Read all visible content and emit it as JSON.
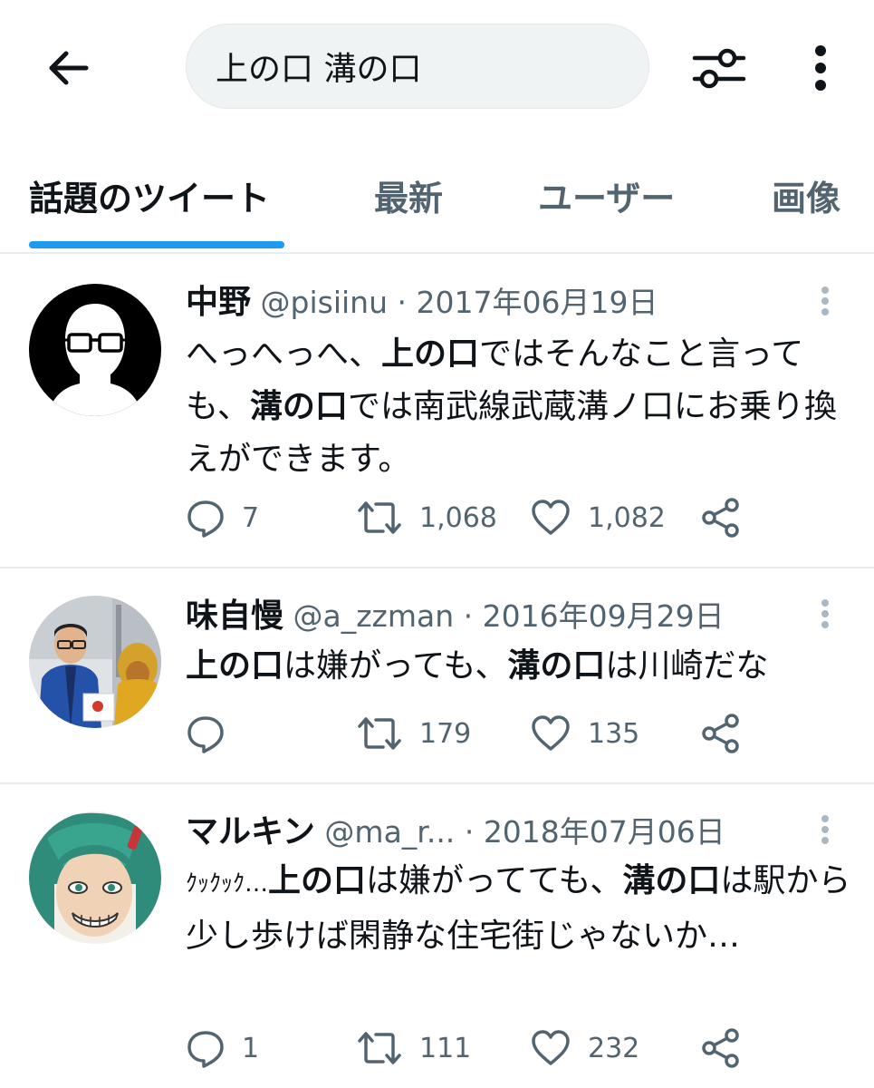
{
  "search": {
    "query": "上の口 溝の口"
  },
  "tabs": [
    {
      "label": "話題のツイート",
      "active": true
    },
    {
      "label": "最新",
      "active": false
    },
    {
      "label": "ユーザー",
      "active": false
    },
    {
      "label": "画像",
      "active": false
    }
  ],
  "tweets": [
    {
      "name": "中野",
      "handle": "@pisiinu",
      "separator": "·",
      "date": "2017年06月19日",
      "text_parts": [
        {
          "t": "へっへっへ、",
          "b": false
        },
        {
          "t": "上の口",
          "b": true
        },
        {
          "t": "ではそんなこと言っても、",
          "b": false
        },
        {
          "t": "溝の口",
          "b": true
        },
        {
          "t": "では南武線武蔵溝ノ口にお乗り換えができます。",
          "b": false
        }
      ],
      "replies": "7",
      "retweets": "1,068",
      "likes": "1,082"
    },
    {
      "name": "味自慢",
      "handle": "@a_zzman",
      "separator": "·",
      "date": "2016年09月29日",
      "text_parts": [
        {
          "t": "上の口",
          "b": true
        },
        {
          "t": "は嫌がっても、",
          "b": false
        },
        {
          "t": "溝の口",
          "b": true
        },
        {
          "t": "は川崎だな",
          "b": false
        }
      ],
      "replies": "",
      "retweets": "179",
      "likes": "135"
    },
    {
      "name": "マルキン",
      "handle": "@ma_r...",
      "separator": "·",
      "date": "2018年07月06日",
      "text_parts": [
        {
          "t": "ｸｯｸｯｸ…",
          "b": false
        },
        {
          "t": "上の口",
          "b": true
        },
        {
          "t": "は嫌がってても、",
          "b": false
        },
        {
          "t": "溝の口",
          "b": true
        },
        {
          "t": "は駅から少し歩けば閑静な住宅街じゃないか…",
          "b": false
        }
      ],
      "replies": "1",
      "retweets": "111",
      "likes": "232"
    }
  ],
  "colors": {
    "accent": "#1d9bf0",
    "text_primary": "#0f1419",
    "text_secondary": "#536471",
    "divider": "#e6ecf0",
    "search_bg": "#eff3f4"
  },
  "icons": {
    "back": "arrow-left-icon",
    "filter": "sliders-icon",
    "more": "vertical-ellipsis-icon",
    "reply": "speech-bubble-icon",
    "retweet": "retweet-icon",
    "like": "heart-icon",
    "share": "share-icon"
  }
}
